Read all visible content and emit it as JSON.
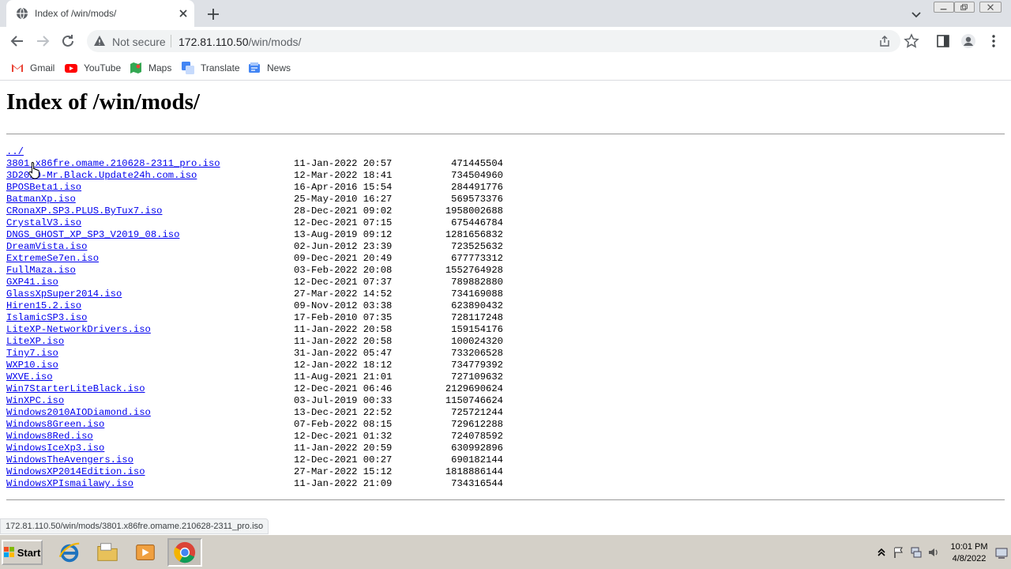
{
  "browser": {
    "tab": {
      "title": "Index of /win/mods/"
    },
    "omnibox": {
      "security_label": "Not secure",
      "url_host": "172.81.110.50",
      "url_path": "/win/mods/"
    },
    "bookmarks": [
      {
        "label": "Gmail",
        "icon": "gmail-icon"
      },
      {
        "label": "YouTube",
        "icon": "youtube-icon"
      },
      {
        "label": "Maps",
        "icon": "maps-icon"
      },
      {
        "label": "Translate",
        "icon": "translate-icon"
      },
      {
        "label": "News",
        "icon": "news-icon"
      }
    ],
    "status_url": "172.81.110.50/win/mods/3801.x86fre.omame.210628-2311_pro.iso"
  },
  "page": {
    "heading": "Index of /win/mods/",
    "parent_link": "../",
    "files": [
      {
        "name": "3801.x86fre.omame.210628-2311_pro.iso",
        "date": "11-Jan-2022 20:57",
        "size": "471445504"
      },
      {
        "name": "3D2020-Mr.Black.Update24h.com.iso",
        "date": "12-Mar-2022 18:41",
        "size": "734504960"
      },
      {
        "name": "BPOSBeta1.iso",
        "date": "16-Apr-2016 15:54",
        "size": "284491776"
      },
      {
        "name": "BatmanXp.iso",
        "date": "25-May-2010 16:27",
        "size": "569573376"
      },
      {
        "name": "CRonaXP.SP3.PLUS.ByTux7.iso",
        "date": "28-Dec-2021 09:02",
        "size": "1958002688"
      },
      {
        "name": "CrystalV3.iso",
        "date": "12-Dec-2021 07:15",
        "size": "675446784"
      },
      {
        "name": "DNGS_GHOST_XP_SP3_V2019_08.iso",
        "date": "13-Aug-2019 09:12",
        "size": "1281656832"
      },
      {
        "name": "DreamVista.iso",
        "date": "02-Jun-2012 23:39",
        "size": "723525632"
      },
      {
        "name": "ExtremeSe7en.iso",
        "date": "09-Dec-2021 20:49",
        "size": "677773312"
      },
      {
        "name": "FullMaza.iso",
        "date": "03-Feb-2022 20:08",
        "size": "1552764928"
      },
      {
        "name": "GXP41.iso",
        "date": "12-Dec-2021 07:37",
        "size": "789882880"
      },
      {
        "name": "GlassXpSuper2014.iso",
        "date": "27-Mar-2022 14:52",
        "size": "734169088"
      },
      {
        "name": "Hiren15.2.iso",
        "date": "09-Nov-2012 03:38",
        "size": "623890432"
      },
      {
        "name": "IslamicSP3.iso",
        "date": "17-Feb-2010 07:35",
        "size": "728117248"
      },
      {
        "name": "LiteXP-NetworkDrivers.iso",
        "date": "11-Jan-2022 20:58",
        "size": "159154176"
      },
      {
        "name": "LiteXP.iso",
        "date": "11-Jan-2022 20:58",
        "size": "100024320"
      },
      {
        "name": "Tiny7.iso",
        "date": "31-Jan-2022 05:47",
        "size": "733206528"
      },
      {
        "name": "WXP10.iso",
        "date": "12-Jan-2022 18:12",
        "size": "734779392"
      },
      {
        "name": "WXVE.iso",
        "date": "11-Aug-2021 21:01",
        "size": "727109632"
      },
      {
        "name": "Win7StarterLiteBlack.iso",
        "date": "12-Dec-2021 06:46",
        "size": "2129690624"
      },
      {
        "name": "WinXPC.iso",
        "date": "03-Jul-2019 00:33",
        "size": "1150746624"
      },
      {
        "name": "Windows2010AIODiamond.iso",
        "date": "13-Dec-2021 22:52",
        "size": "725721244"
      },
      {
        "name": "Windows8Green.iso",
        "date": "07-Feb-2022 08:15",
        "size": "729612288"
      },
      {
        "name": "Windows8Red.iso",
        "date": "12-Dec-2021 01:32",
        "size": "724078592"
      },
      {
        "name": "WindowsIceXp3.iso",
        "date": "11-Jan-2022 20:59",
        "size": "630992896"
      },
      {
        "name": "WindowsTheAvengers.iso",
        "date": "12-Dec-2021 00:27",
        "size": "690182144"
      },
      {
        "name": "WindowsXP2014Edition.iso",
        "date": "27-Mar-2022 15:12",
        "size": "1818886144"
      },
      {
        "name": "WindowsXPIsmailawy.iso",
        "date": "11-Jan-2022 21:09",
        "size": "734316544"
      }
    ]
  },
  "taskbar": {
    "start_label": "Start",
    "pinned": [
      "internet-explorer-icon",
      "file-explorer-icon",
      "media-player-icon",
      "chrome-icon"
    ],
    "clock_time": "10:01 PM",
    "clock_date": "4/8/2022"
  },
  "colors": {
    "link": "#0000ee",
    "tabstrip": "#dee1e6",
    "taskbar": "#d4d0c8"
  }
}
